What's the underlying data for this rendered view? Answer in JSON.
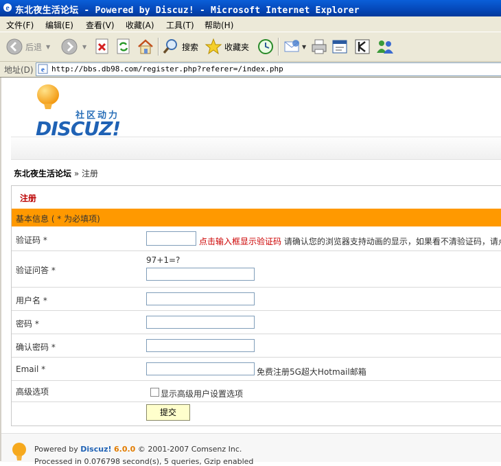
{
  "window": {
    "title": "东北夜生活论坛 - Powered by Discuz! - Microsoft Internet Explorer"
  },
  "menu": [
    "文件(F)",
    "编辑(E)",
    "查看(V)",
    "收藏(A)",
    "工具(T)",
    "帮助(H)"
  ],
  "toolbar": {
    "back_label": "后退",
    "search_label": "搜索",
    "favorites_label": "收藏夹"
  },
  "address": {
    "label": "地址(D)",
    "url": "http://bbs.db98.com/register.php?referer=/index.php"
  },
  "logo": {
    "tagline": "社区动力",
    "wordmark": "DISCUZ!"
  },
  "breadcrumb": {
    "forum": "东北夜生活论坛",
    "current": "» 注册"
  },
  "form": {
    "title": "注册",
    "section_header": "基本信息 ( * 为必填项)",
    "captcha": {
      "label": "验证码 *",
      "link": "点击输入框显示验证码",
      "hint": "请确认您的浏览器支持动画的显示，如果看不清验证码，请点"
    },
    "qa": {
      "label": "验证问答 *",
      "question": "97+1=?"
    },
    "username_label": "用户名 *",
    "password_label": "密码 *",
    "confirm_label": "确认密码 *",
    "email": {
      "label": "Email *",
      "hint": "免费注册5G超大Hotmail邮箱"
    },
    "advanced": {
      "label": "高级选项",
      "checkbox_label": "显示高级用户设置选项"
    },
    "submit_label": "提交"
  },
  "footer": {
    "powered": "Powered by",
    "brand": "Discuz!",
    "version": "6.0.0",
    "copyright": "© 2001-2007 Comsenz Inc.",
    "processed": "Processed in 0.076798 second(s), 5 queries, Gzip enabled"
  }
}
